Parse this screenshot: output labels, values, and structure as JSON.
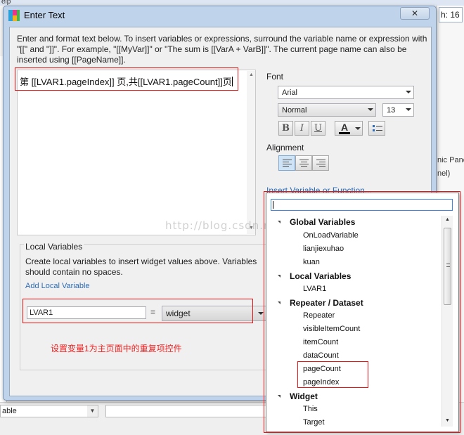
{
  "background": {
    "help_text": "elp",
    "height_label": "h:",
    "height_value": "16",
    "panel_text_1": "nic Panel",
    "panel_text_2": "nel)",
    "bottom_combo": "able"
  },
  "dialog": {
    "title": "Enter Text",
    "close_label": "✕",
    "instructions": "Enter and format text below. To insert variables or expressions, surround the variable name or expression with \"[[\" and \"]]\". For example, \"[[MyVar]]\" or \"The sum is [[VarA + VarB]]\". The current page name can also be inserted using [[PageName]].",
    "editor_text": "第 [[LVAR1.pageIndex]] 页,共[[LVAR1.pageCount]]页"
  },
  "font": {
    "label": "Font",
    "family": "Arial",
    "style": "Normal",
    "size": "13",
    "bold": "B",
    "italic": "I",
    "underline": "U",
    "font_color_glyph": "A"
  },
  "alignment": {
    "label": "Alignment"
  },
  "insert_link": "Insert Variable or Function...",
  "local_variables": {
    "title": "Local Variables",
    "description": "Create local variables to insert widget values above. Variables should contain no spaces.",
    "add_link": "Add Local Variable",
    "name": "LVAR1",
    "equals": "=",
    "type": "widget",
    "annotation": "设置变量1为主页面中的重复项控件"
  },
  "variable_menu": {
    "groups": [
      {
        "label": "Global Variables",
        "items": [
          "OnLoadVariable",
          "lianjiexuhao",
          "kuan"
        ]
      },
      {
        "label": "Local Variables",
        "items": [
          "LVAR1"
        ]
      },
      {
        "label": "Repeater / Dataset",
        "items": [
          "Repeater",
          "visibleItemCount",
          "itemCount",
          "dataCount",
          "pageCount",
          "pageIndex"
        ]
      },
      {
        "label": "Widget",
        "items": [
          "This",
          "Target"
        ]
      }
    ]
  },
  "watermark": "http://blog.csdn.net/",
  "colors": {
    "highlight_red": "#e11111",
    "link_blue": "#2d6bb5",
    "annotation_red": "#e22222",
    "font_color_swatch": "#000000"
  }
}
